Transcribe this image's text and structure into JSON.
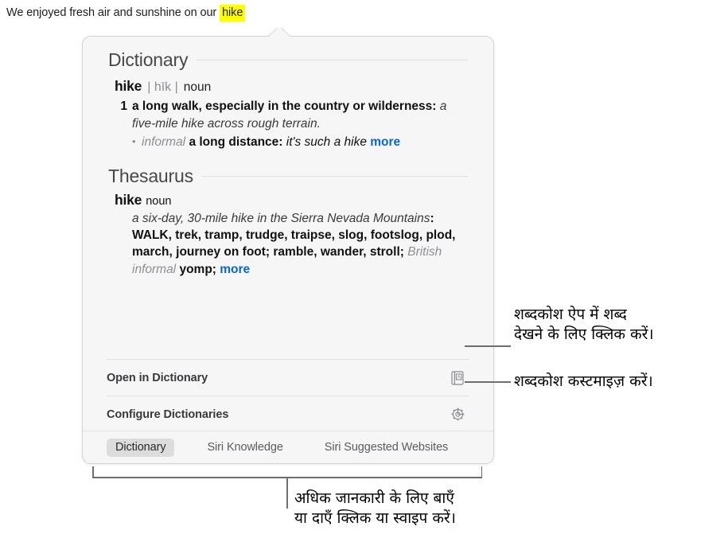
{
  "sentence": {
    "before": "We enjoyed fresh air and sunshine on our ",
    "highlighted_word": "hike",
    "highlight_color": "#ffff00"
  },
  "popover": {
    "dictionary": {
      "section_title": "Dictionary",
      "headword": "hike",
      "pronunciation": "| hīk |",
      "part_of_speech": "noun",
      "sense_number": "1",
      "sense_definition_bold": "a long walk, especially in the country or wilderness:",
      "sense_example": " a five-mile hike across rough terrain.",
      "subsense_bullet": "•",
      "subsense_label": "informal",
      "subsense_definition_bold": "a long distance:",
      "subsense_example": " it's such a hike",
      "more_label": "more"
    },
    "thesaurus": {
      "section_title": "Thesaurus",
      "headword": "hike",
      "part_of_speech": "noun",
      "example": "a six-day, 30-mile hike in the Sierra Nevada Mountains",
      "colon": ": ",
      "primary_synonym": "WALK",
      "synonyms_rest": ", trek, tramp, trudge, traipse, slog, footslog, plod, march, journey on foot; ramble, wander, stroll; ",
      "regional_label": "British informal",
      "regional_synonym": " yomp; ",
      "more_label": "more"
    },
    "actions": [
      {
        "label": "Open in Dictionary",
        "icon": "dictionary-book-icon"
      },
      {
        "label": "Configure Dictionaries",
        "icon": "gear-icon"
      }
    ],
    "tabs": [
      {
        "label": "Dictionary",
        "selected": true
      },
      {
        "label": "Siri Knowledge",
        "selected": false
      },
      {
        "label": "Siri Suggested Websites",
        "selected": false
      }
    ]
  },
  "annotations": {
    "open_in_dictionary": {
      "line1": "शब्दकोश ऐप में शब्द",
      "line2": "देखने के लिए क्लिक करें।"
    },
    "configure_dictionaries": {
      "line1": "शब्दकोश कस्टमाइज़ करें।"
    },
    "tabs_hint": {
      "line1": "अधिक जानकारी के लिए बाएँ",
      "line2": "या दाएँ क्लिक या स्वाइप करें।"
    }
  },
  "colors": {
    "link": "#0a66d0",
    "popover_background": "#f6f6f6",
    "popover_border": "#d3d3d3",
    "selected_tab_background": "#dcdcdc",
    "leader_line": "#6e6e6e"
  }
}
